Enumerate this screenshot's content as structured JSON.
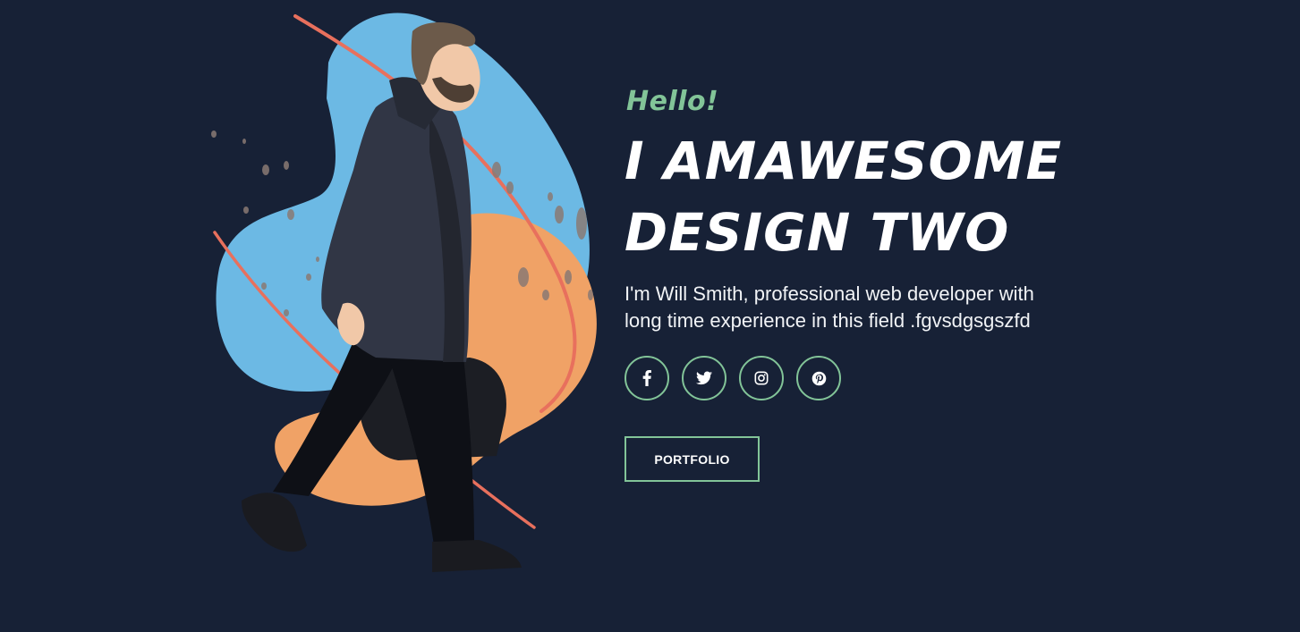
{
  "hero": {
    "greeting": "Hello!",
    "headline_line1": "I AMAWESOME",
    "headline_line2": "DESIGN TWO",
    "bio": "I'm Will Smith, professional web developer with long time experience in this field .fgvsdgsgszfd",
    "portfolio_label": "PORTFOLIO"
  },
  "socials": [
    {
      "name": "facebook",
      "icon": "facebook-icon"
    },
    {
      "name": "twitter",
      "icon": "twitter-icon"
    },
    {
      "name": "instagram",
      "icon": "instagram-icon"
    },
    {
      "name": "pinterest",
      "icon": "pinterest-icon"
    }
  ],
  "colors": {
    "background": "#172136",
    "accent": "#82c498",
    "text": "#ffffff",
    "blob_blue": "#6cb9e4",
    "blob_orange": "#f0a266",
    "stroke_red": "#e8705d"
  },
  "illustration": {
    "subject": "man walking in dark coat carrying a bag"
  }
}
